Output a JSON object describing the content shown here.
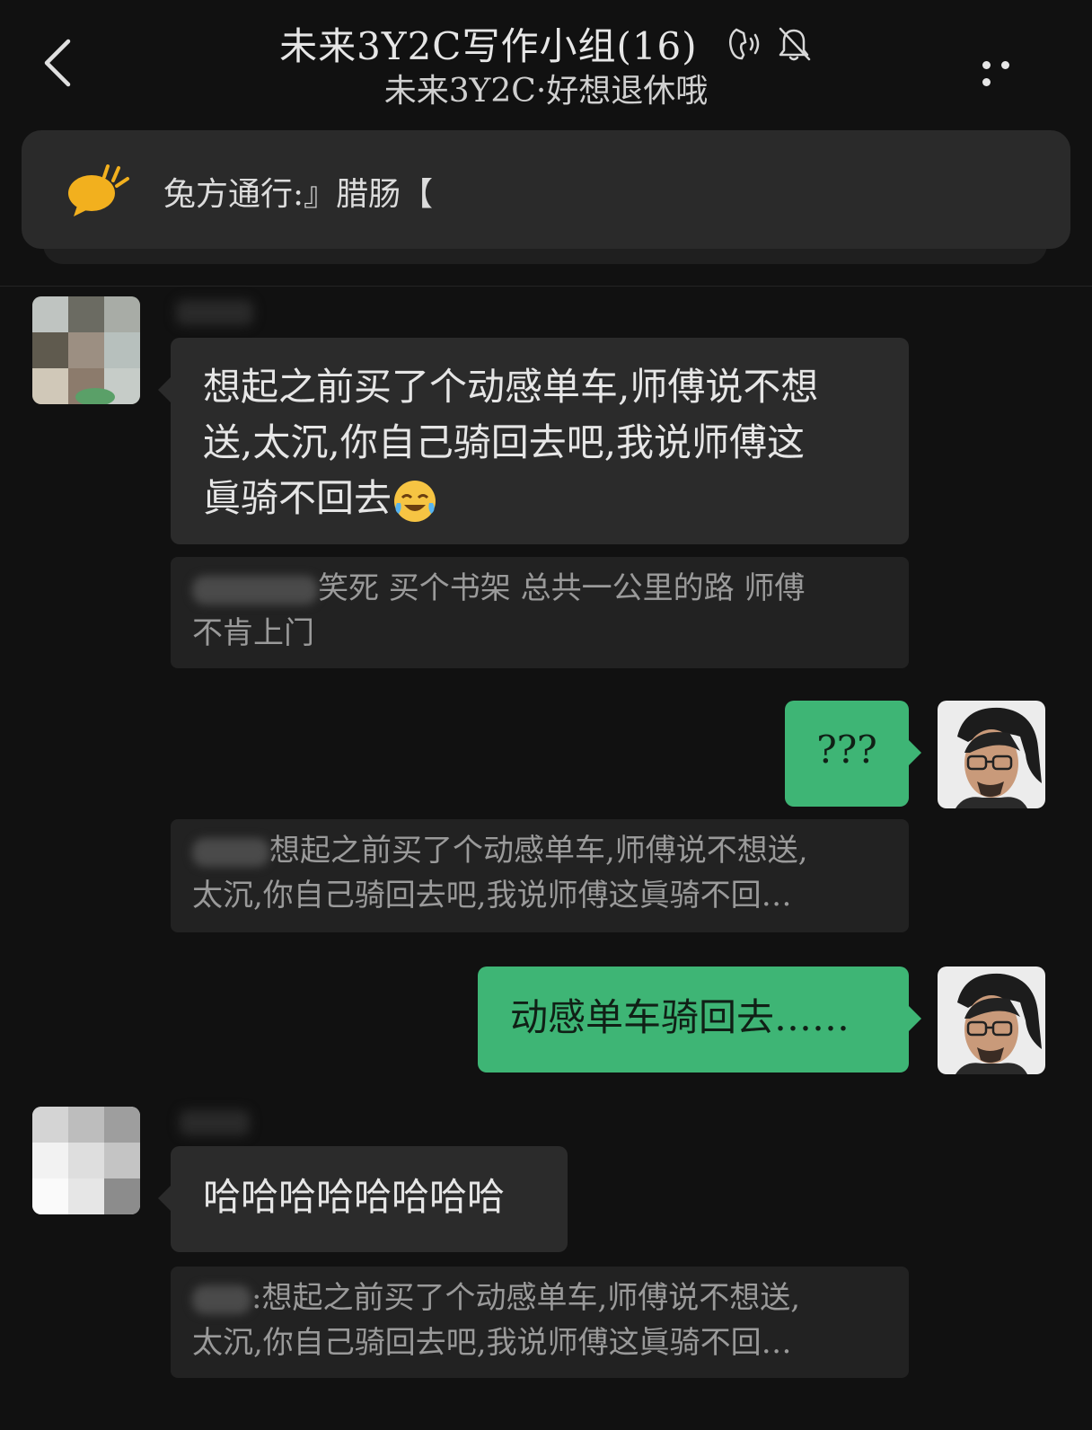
{
  "header": {
    "title": "未来3Y2C写作小组(16)",
    "subtitle": "未来3Y2C·好想退休哦"
  },
  "notice": {
    "text": "兔方通行:』腊肠【"
  },
  "messages": [
    {
      "side": "left",
      "text_line1": "想起之前买了个动感单车,师傅说不想",
      "text_line2": "送,太沉,你自己骑回去吧,我说师傅这",
      "text_line3": "眞骑不回去",
      "emoji": "crying-laughing-emoji",
      "quote_line1": "笑死 买个书架 总共一公里的路 师傅",
      "quote_line2": "不肯上门"
    },
    {
      "side": "right",
      "text": "???",
      "quote_line1": "想起之前买了个动感单车,师傅说不想送,",
      "quote_line2": "太沉,你自己骑回去吧,我说师傅这眞骑不回…"
    },
    {
      "side": "right",
      "text": "动感单车骑回去……"
    },
    {
      "side": "left",
      "text": "哈哈哈哈哈哈哈哈",
      "quote_line1": ":想起之前买了个动感单车,师傅说不想送,",
      "quote_line2": "太沉,你自己骑回去吧,我说师傅这眞骑不回…"
    }
  ],
  "icons": {
    "back": "chevron-left-icon",
    "earpiece": "earpiece-speaker-icon",
    "mute": "bell-off-icon",
    "more": "more-dots-icon",
    "notice": "speech-bubble-sun-icon"
  },
  "colors": {
    "background": "#111111",
    "bubble_left": "#2b2b2b",
    "bubble_right": "#3eb575",
    "quote_bg": "#222222",
    "notice_icon": "#f2b01e"
  }
}
